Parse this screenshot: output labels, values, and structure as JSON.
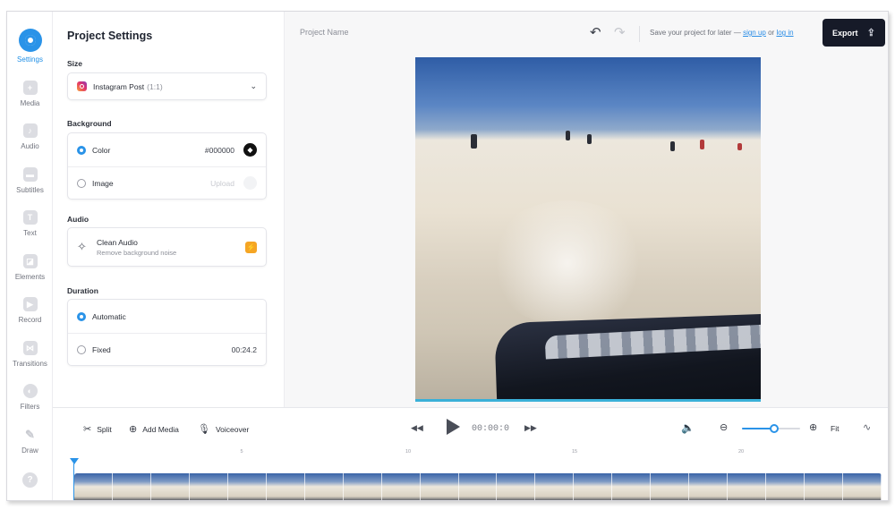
{
  "rail": {
    "items": [
      {
        "label": "Settings",
        "icon": "gear-icon",
        "active": true
      },
      {
        "label": "Media",
        "icon": "plus-icon"
      },
      {
        "label": "Audio",
        "icon": "music-note-icon"
      },
      {
        "label": "Subtitles",
        "icon": "subtitles-icon"
      },
      {
        "label": "Text",
        "icon": "text-icon"
      },
      {
        "label": "Elements",
        "icon": "elements-icon"
      },
      {
        "label": "Record",
        "icon": "record-icon"
      },
      {
        "label": "Transitions",
        "icon": "transitions-icon"
      },
      {
        "label": "Filters",
        "icon": "filters-icon"
      },
      {
        "label": "Draw",
        "icon": "pencil-icon"
      }
    ],
    "help_icon": "?"
  },
  "panel": {
    "title": "Project Settings",
    "size": {
      "label": "Size",
      "value": "Instagram Post",
      "value_suffix": "(1:1)"
    },
    "background": {
      "label": "Background",
      "color_label": "Color",
      "color_value": "#000000",
      "image_label": "Image",
      "upload_label": "Upload"
    },
    "audio": {
      "label": "Audio",
      "title": "Clean Audio",
      "subtitle": "Remove background noise"
    },
    "duration": {
      "label": "Duration",
      "automatic_label": "Automatic",
      "fixed_label": "Fixed",
      "fixed_value": "00:24.2"
    }
  },
  "topbar": {
    "project_name": "Project Name",
    "save_text": "Save your project for later —",
    "sign_up": "sign up",
    "or": "or",
    "log_in": "log in",
    "export_label": "Export"
  },
  "timeline": {
    "split_label": "Split",
    "add_media_label": "Add Media",
    "voiceover_label": "Voiceover",
    "timecode": "00:00:0",
    "fit_label": "Fit",
    "zoom_level": 0.55,
    "ruler_ticks": [
      "5",
      "10",
      "15",
      "20"
    ]
  },
  "colors": {
    "accent": "#2a93e8",
    "export_bg": "#161a28",
    "clean_audio_badge": "#f5a524"
  }
}
